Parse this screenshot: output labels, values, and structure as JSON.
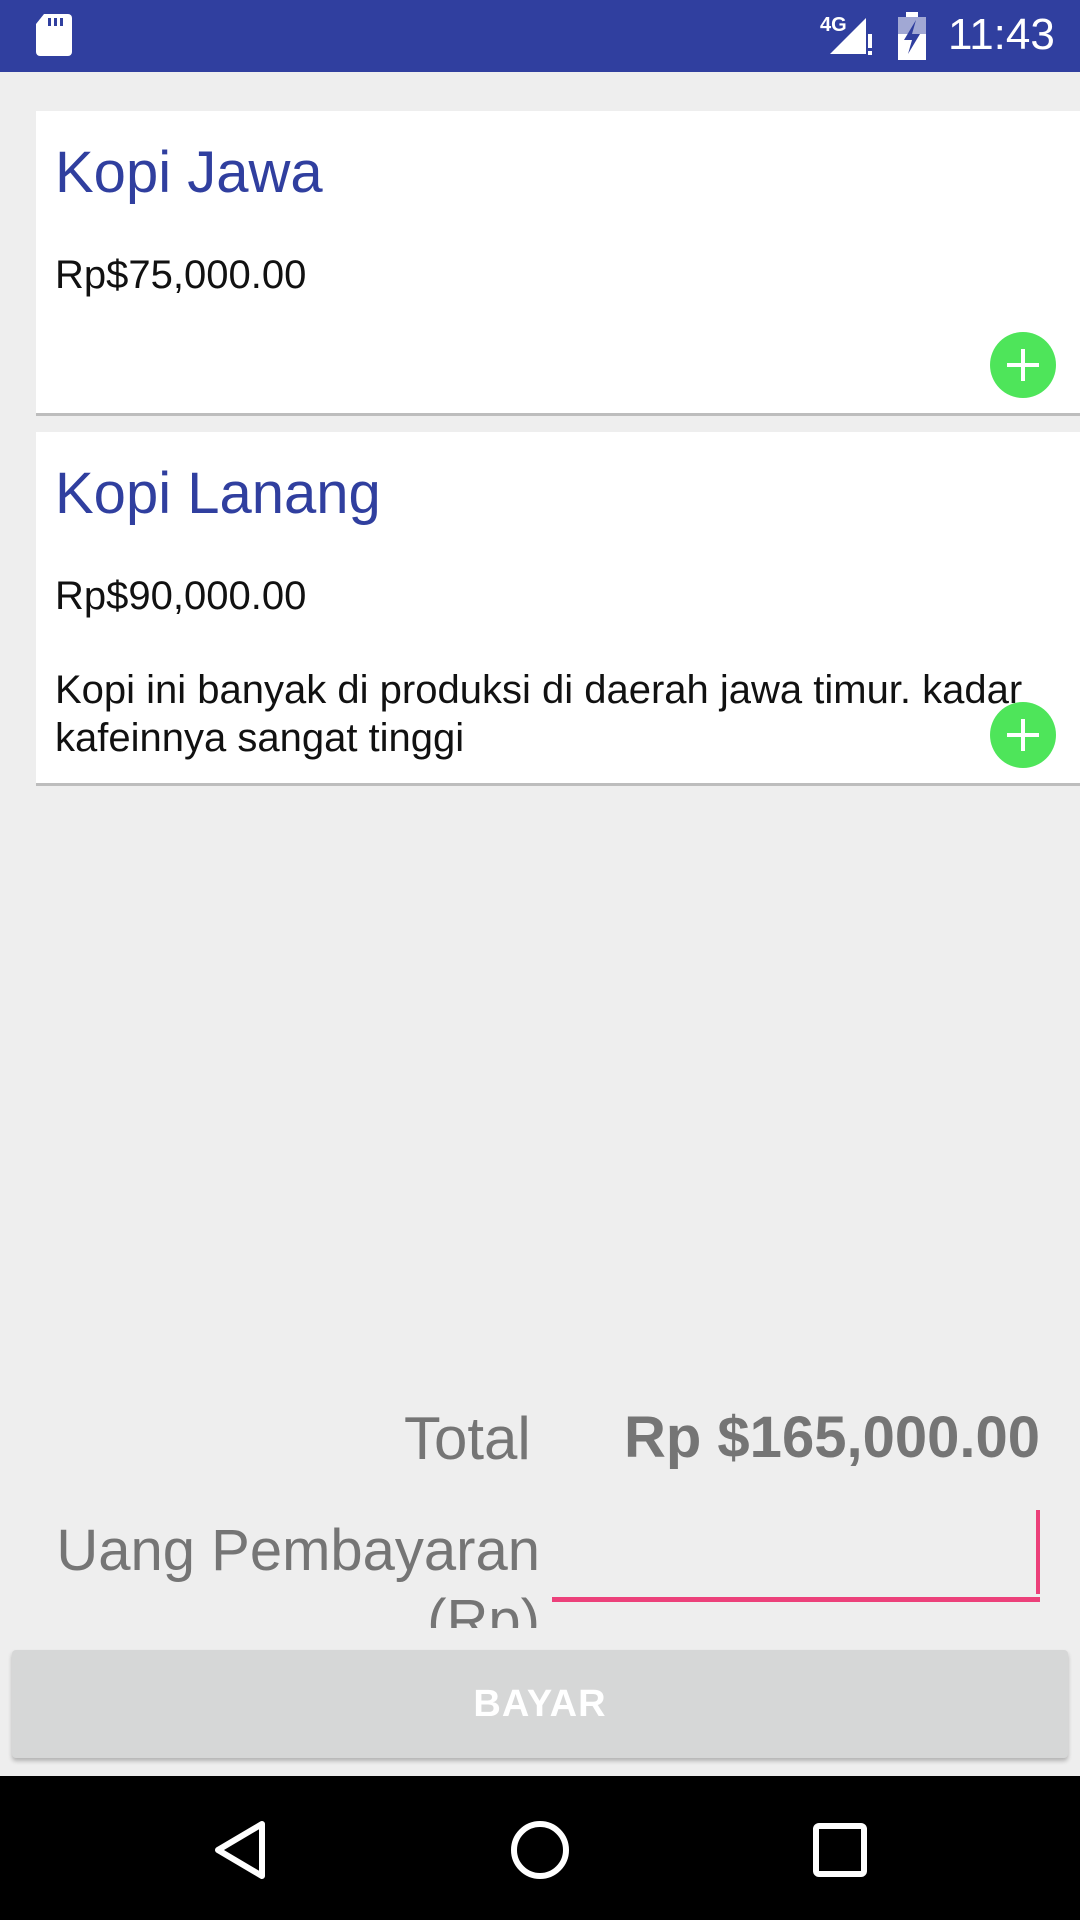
{
  "status_bar": {
    "network": "4G",
    "time": "11:43",
    "icons": [
      "sd-card-icon",
      "signal-icon",
      "battery-icon"
    ]
  },
  "products": [
    {
      "name": "Kopi Jawa",
      "price": "Rp$75,000.00",
      "description": ""
    },
    {
      "name": "Kopi Lanang",
      "price": "Rp$90,000.00",
      "description": "Kopi ini banyak di produksi di daerah jawa timur. kadar kafeinnya sangat tinggi"
    }
  ],
  "summary": {
    "total_label": "Total",
    "total_value": "Rp $165,000.00",
    "payment_label": "Uang Pembayaran (Rp)",
    "payment_value": ""
  },
  "actions": {
    "pay_label": "BAYAR"
  },
  "navigation": {
    "icons": [
      "back-icon",
      "home-icon",
      "recents-icon"
    ]
  },
  "colors": {
    "status_bar": "#303f9f",
    "title": "#303f9f",
    "add_button": "#4ee55a",
    "input_accent": "#ec407a",
    "button_disabled": "#d6d7d7"
  }
}
